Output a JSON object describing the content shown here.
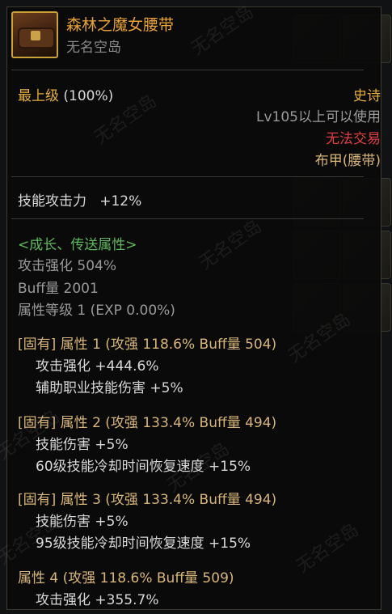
{
  "item": {
    "name": "森林之魔女腰带",
    "source": "无名空岛"
  },
  "grade": {
    "label": "最上级",
    "percent": "(100%)",
    "rarity": "史诗"
  },
  "requirements": {
    "level": "Lv105以上可以使用",
    "trade": "无法交易",
    "type": "布甲(腰带)"
  },
  "base_stat": {
    "label": "技能攻击力",
    "value": "+12%"
  },
  "growth": {
    "header": "<成长、传送属性>",
    "attack": "攻击强化 504%",
    "buff": "Buff量 2001",
    "level": "属性等级 1 (EXP 0.00%)"
  },
  "attributes": [
    {
      "title": "[固有] 属性 1 (攻强 118.6%    Buff量 504)",
      "lines": [
        "攻击强化 +444.6%",
        "辅助职业技能伤害 +5%"
      ]
    },
    {
      "title": "[固有] 属性 2 (攻强 133.4%    Buff量 494)",
      "lines": [
        "技能伤害 +5%",
        "60级技能冷却时间恢复速度 +15%"
      ]
    },
    {
      "title": "[固有] 属性 3 (攻强 133.4%    Buff量 494)",
      "lines": [
        "技能伤害 +5%",
        "95级技能冷却时间恢复速度 +15%"
      ]
    },
    {
      "title": "属性 4 (攻强 118.6%    Buff量 509)",
      "lines": [
        "攻击强化 +355.7%"
      ]
    }
  ],
  "watermark_text": "无名空岛",
  "colors": {
    "item_name": "#e8a236",
    "rarity": "#e6b03a",
    "untradable": "#e24040",
    "growth_header": "#5fb85f",
    "attribute_title": "#d8b679"
  }
}
